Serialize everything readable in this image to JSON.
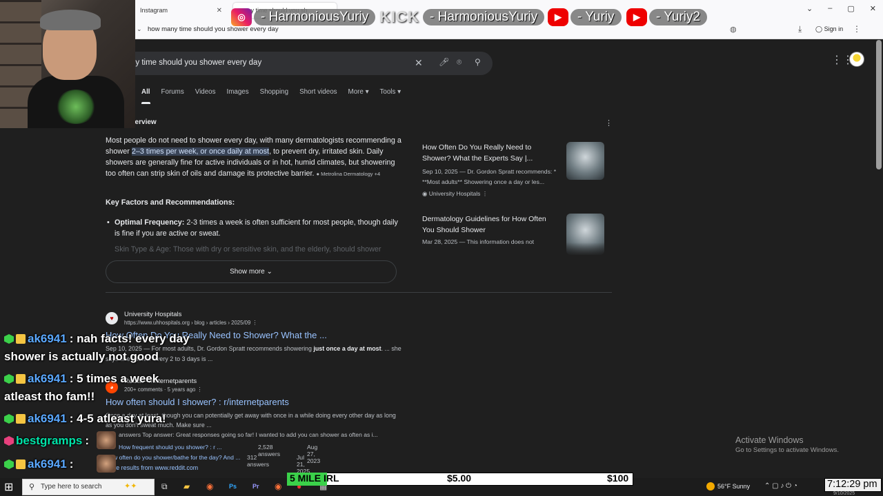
{
  "browser": {
    "tabs": [
      {
        "label": "Instagram"
      },
      {
        "label": "many time should you sh"
      }
    ],
    "url": "how many time should you shower every day",
    "sign_in": "Sign in",
    "controls": {
      "min": "–",
      "max": "▢",
      "close": "✕",
      "chevron": "⌄"
    }
  },
  "overlay": {
    "instagram_handle": "- HarmoniousYuriy",
    "kick_logo": "KICK",
    "kick_handle": "- HarmoniousYuriy",
    "yt1_handle": "- Yuriy",
    "yt2_handle": "- Yuriy2"
  },
  "google": {
    "query": "ny time should you shower every day",
    "tabs": [
      "All",
      "Forums",
      "Videos",
      "Images",
      "Shopping",
      "Short videos",
      "More ▾",
      "Tools ▾"
    ],
    "ai_overview": {
      "title": "verview",
      "para_a": "Most people do not need to shower every day, with many dermatologists recommending a shower ",
      "highlight": "2–3 times per week, or once daily at most",
      "para_b": ", to prevent dry, irritated skin. Daily showers are generally fine for active individuals or in hot, humid climates, but showering too often can strip skin of oils and damage its protective barrier.",
      "chip": "● Metrolina Dermatology +4",
      "heading": "Key Factors and Recommendations:",
      "bullet_label": "Optimal Frequency:",
      "bullet_text": " 2-3 times a week is often sufficient for most people, though daily is fine if you are active or sweat.",
      "faded": "Skin Type & Age: Those with dry or sensitive skin, and the elderly, should shower",
      "show_more": "Show more ⌄"
    },
    "cards": [
      {
        "title": "How Often Do You Really Need to Shower? What the Experts Say |...",
        "snippet": "Sep 10, 2025 — Dr. Gordon Spratt recommends: * **Most adults** Showering once a day or les...",
        "source": "University Hospitals"
      },
      {
        "title": "Dermatology Guidelines for How Often You Should Shower",
        "snippet": "Mar 28, 2025 — This information does not"
      }
    ],
    "results": [
      {
        "site": "University Hospitals",
        "url": "https://www.uhhospitals.org › blog › articles › 2025/09",
        "title": "How Often Do You Really Need to Shower? What the ...",
        "snippet_a": "Sep 10, 2025 — For most adults, Dr. Gordon Spratt recommends showering ",
        "snippet_bold": "just once a day at most",
        "snippet_b": ". ... she says one shower every 2 to 3 days is ..."
      },
      {
        "site": "Reddit · r/internetparents",
        "meta": "200+ comments · 5 years ago",
        "title": "How often should I shower? : r/internetparents",
        "snippet": "Once a day at least, though you can potentially get away with once in a while doing every other day as long as you don't sweat much. Make sure ...",
        "answers": "answers  Top answer: Great responses going so far! I wanted to add you can shower as often as i...",
        "subresults": [
          {
            "title": "How frequent should you shower? : r ...",
            "count": "2,528 answers",
            "date": "Aug 27, 2023"
          },
          {
            "title": "How often do you shower/bathe for the day? And ...",
            "count": "312 answers",
            "date": "Jul 21, 2025"
          }
        ],
        "more": "More results from www.reddit.com"
      }
    ]
  },
  "chat": [
    {
      "user": "ak6941",
      "text": ": nah facts! every day"
    },
    {
      "cont": "shower is actually not good"
    },
    {
      "user": "ak6941",
      "text": ": 5 times a week"
    },
    {
      "cont": "atleast tho fam!!"
    },
    {
      "user": "ak6941",
      "text": ": 4-5 atleast yura!"
    },
    {
      "user": "bestgramps",
      "text": ":"
    },
    {
      "user": "ak6941",
      "text": ":"
    }
  ],
  "windows": {
    "activate_title": "Activate Windows",
    "activate_sub": "Go to Settings to activate Windows."
  },
  "goal": {
    "name": "5 MILE IRL",
    "current": "$5.00",
    "target": "$100",
    "progress": 0.05
  },
  "taskbar": {
    "search_placeholder": "Type here to search",
    "weather": "56°F  Sunny",
    "clock": "7:12:29 pm",
    "date": "9/10/2025"
  },
  "colors": {
    "accent_link": "#99c3ff",
    "highlight": "#394457",
    "goal_fill": "#3bd14a"
  }
}
